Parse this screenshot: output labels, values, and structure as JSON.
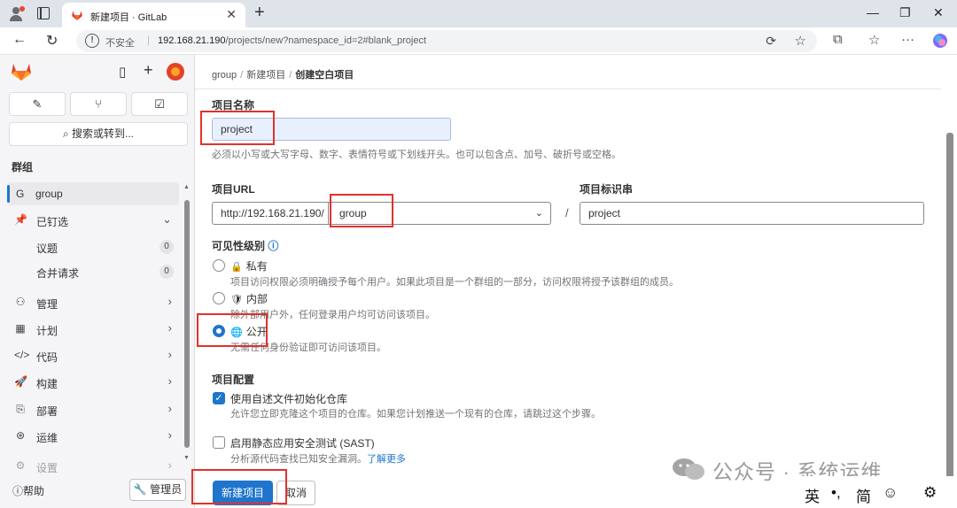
{
  "browser": {
    "tab_title": "新建项目 · GitLab",
    "insecure_label": "不安全",
    "url_host": "192.168.21.190",
    "url_path": "/projects/new?namespace_id=2#blank_project"
  },
  "sidebar": {
    "search_label": "搜索或转到...",
    "section_title": "群组",
    "group_initial": "G",
    "group_name": "group",
    "pinned_label": "已钉选",
    "pinned_items": [
      {
        "label": "议题",
        "count": "0"
      },
      {
        "label": "合并请求",
        "count": "0"
      }
    ],
    "nav_items": [
      {
        "label": "管理",
        "icon": "manage-icon"
      },
      {
        "label": "计划",
        "icon": "plan-icon"
      },
      {
        "label": "代码",
        "icon": "code-icon"
      },
      {
        "label": "构建",
        "icon": "build-icon"
      },
      {
        "label": "部署",
        "icon": "deploy-icon"
      },
      {
        "label": "运维",
        "icon": "operate-icon"
      },
      {
        "label": "设置",
        "icon": "settings-icon"
      }
    ],
    "help_label": "帮助",
    "admin_label": "管理员"
  },
  "breadcrumb": {
    "items": [
      "group",
      "新建项目",
      "创建空白项目"
    ]
  },
  "form": {
    "project_name_label": "项目名称",
    "project_name_value": "project",
    "project_name_help": "必须以小写或大写字母、数字、表情符号或下划线开头。也可以包含点、加号、破折号或空格。",
    "project_url_label": "项目URL",
    "project_url_prefix": "http://192.168.21.190/",
    "namespace_value": "group",
    "url_separator": "/",
    "project_slug_label": "项目标识串",
    "project_slug_value": "project",
    "visibility_label": "可见性级别",
    "visibility_options": [
      {
        "label": "私有",
        "desc": "项目访问权限必须明确授予每个用户。如果此项目是一个群组的一部分，访问权限将授予该群组的成员。",
        "selected": false
      },
      {
        "label": "内部",
        "desc": "除外部用户外，任何登录用户均可访问该项目。",
        "selected": false
      },
      {
        "label": "公开",
        "desc": "无需任何身份验证即可访问该项目。",
        "selected": true
      }
    ],
    "config_label": "项目配置",
    "init_readme_label": "使用自述文件初始化仓库",
    "init_readme_desc": "允许您立即克隆这个项目的仓库。如果您计划推送一个现有的仓库，请跳过这个步骤。",
    "init_readme_checked": true,
    "sast_label": "启用静态应用安全测试 (SAST)",
    "sast_desc": "分析源代码查找已知安全漏洞。",
    "sast_link": "了解更多",
    "sast_checked": false,
    "create_button": "新建项目",
    "cancel_button": "取消"
  },
  "watermark": "公众号 · 系统运维",
  "ime": {
    "lang": "英",
    "punct": "•,",
    "mode": "简"
  },
  "colors": {
    "accent": "#1f75cb",
    "highlight_box": "#e0322d",
    "gitlab_orange": "#e24329"
  }
}
